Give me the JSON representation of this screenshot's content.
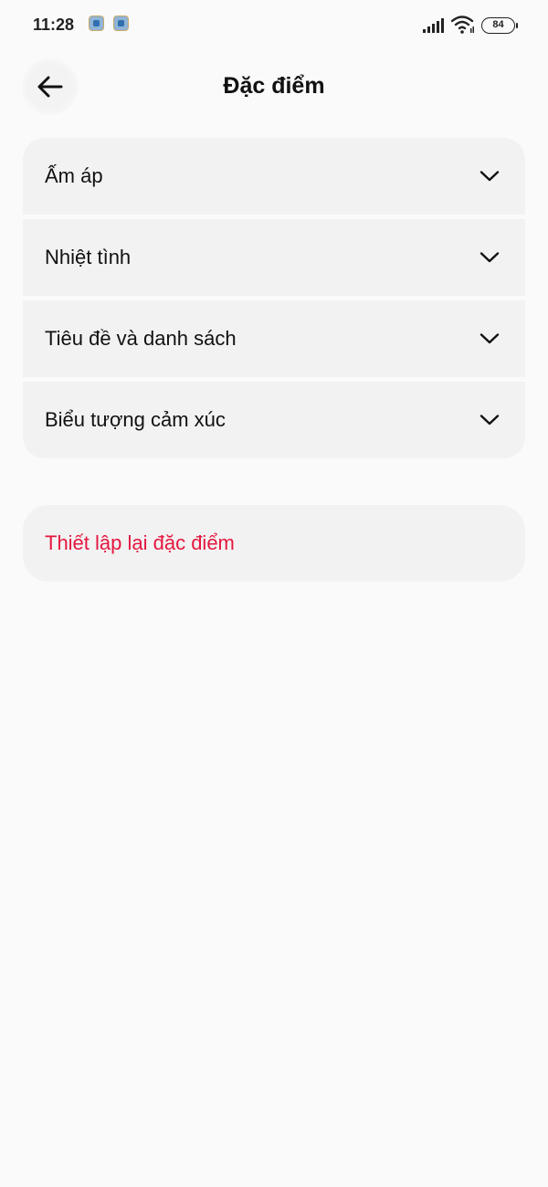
{
  "status_bar": {
    "time": "11:28",
    "battery": "84",
    "icons": [
      "app-notification-icon",
      "app-notification-icon",
      "signal-icon",
      "wifi-icon",
      "battery-icon"
    ]
  },
  "header": {
    "title": "Đặc điểm",
    "back_icon": "arrow-left-icon"
  },
  "traits": {
    "items": [
      {
        "label": "Ấm áp",
        "icon": "chevron-down-icon"
      },
      {
        "label": "Nhiệt tình",
        "icon": "chevron-down-icon"
      },
      {
        "label": "Tiêu đề và danh sách",
        "icon": "chevron-down-icon"
      },
      {
        "label": "Biểu tượng cảm xúc",
        "icon": "chevron-down-icon"
      }
    ]
  },
  "reset": {
    "label": "Thiết lập lại đặc điểm"
  },
  "colors": {
    "background": "#fafafa",
    "card": "#f2f2f2",
    "danger": "#e5173f",
    "text": "#111111"
  }
}
